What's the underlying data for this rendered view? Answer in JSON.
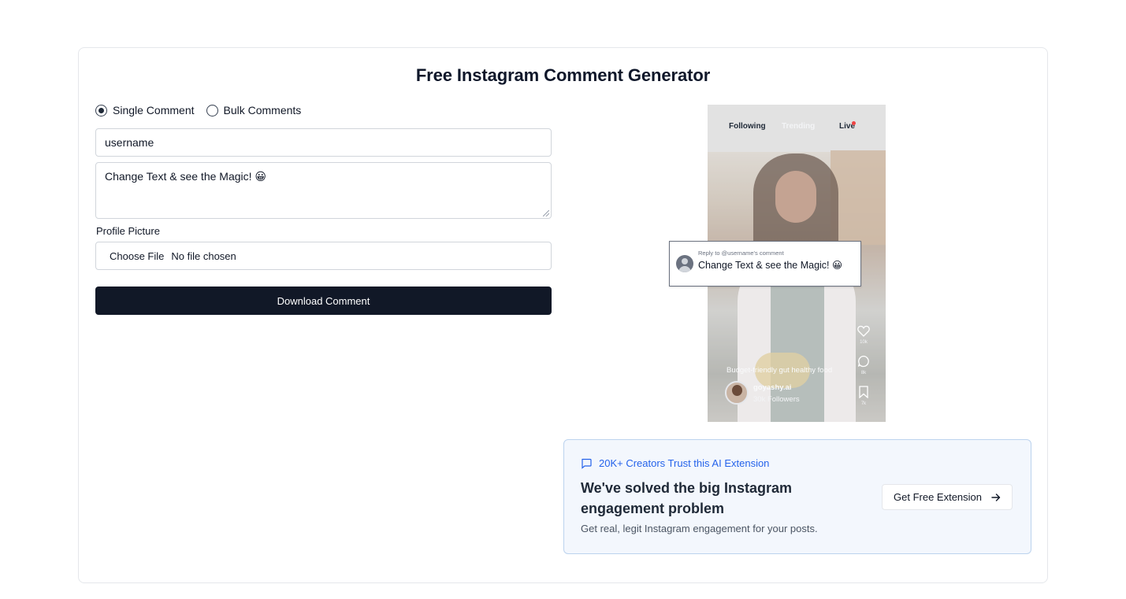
{
  "page": {
    "title": "Free Instagram Comment Generator"
  },
  "form": {
    "modes": [
      {
        "label": "Single Comment",
        "selected": true
      },
      {
        "label": "Bulk Comments",
        "selected": false
      }
    ],
    "username_value": "username",
    "comment_value": "Change Text & see the Magic! 😀",
    "profile_picture_label": "Profile Picture",
    "file_button_label": "Choose File",
    "file_status": "No file chosen",
    "download_label": "Download Comment"
  },
  "preview": {
    "nav": {
      "following": "Following",
      "trending": "Trending",
      "live": "Live"
    },
    "comment": {
      "reply_to": "Reply to @username's comment",
      "text": "Change Text & see the Magic! 😀"
    },
    "caption": "Budget-friendly gut healthy food",
    "author": {
      "name": "goyashy.ai",
      "followers": "30k Followers"
    },
    "counts": {
      "likes": "10k",
      "comments": "8k",
      "saves": "7k"
    },
    "icons": [
      "heart-icon",
      "comment-icon",
      "bookmark-icon"
    ]
  },
  "promo": {
    "badge": "20K+ Creators Trust this AI Extension",
    "heading": "We've solved the big Instagram engagement problem",
    "subtext": "Get real, legit Instagram engagement for your posts.",
    "button_label": "Get Free Extension",
    "accent_color": "#2563eb"
  },
  "colors": {
    "primary_button": "#111827",
    "promo_background": "#f3f7fd"
  }
}
